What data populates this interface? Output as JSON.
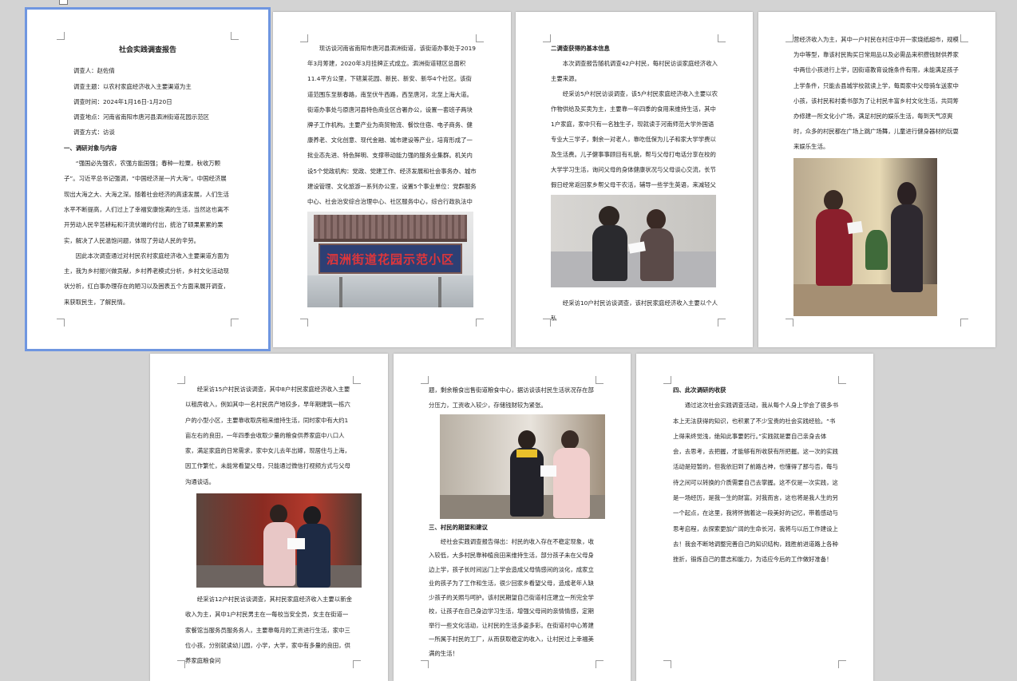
{
  "colors": {
    "background": "#d3d3d3",
    "selection": "#6f96e0"
  },
  "page1": {
    "title": "社会实践调查报告",
    "meta": [
      "调查人：赵佐倩",
      "调查主题：以农村家庭经济收入主要渠道为主",
      "调查时间：2024年1月16日-1月20日",
      "调查地点：河南省南阳市唐河县泗洲街道花园示范区",
      "调查方式：访谈"
    ],
    "heading1": "一、调研对象与内容",
    "paras": [
      "“强国必先强农，农强方能国强；春种一粒粟，秋收万颗子”。习近平总书记强调，“中国经济是一片大海”。中国经济展现出大海之大、大海之深。随着社会经济的高速发展，人们生活水平不断提高，人们过上了幸福安康饱满的生活，当然这也离不开劳动人民辛苦耕耘和汗流伏端的付出，统治了硕果累累的果实，解决了人民温饱问题，体现了劳动人民的辛劳。",
      "因此本次调查通过对村民农村家庭经济收入主要渠道方面为主，我为乡村振兴做贡献，乡村养老模式分析，乡村文化活动现状分析，红白事办理存在的陋习以及困表五个方面来展开调查，来获取民生，了解民情。"
    ]
  },
  "page2": {
    "paras": [
      "现访谈河南省南阳市唐河县泗洲街道，该街道办事处于2019年3月筹建，2020年3月挂牌正式成立。泗洲街道辖区总面积11.4平方公里，下辖莱花园、新民、新安、新华4个社区。该街道范围东至新春路，南至伏牛西路，西至唐河，北至上海大道。街道办事处与原唐河县特色商业区合署办公，设置一套班子两块牌子工作机构。主要产业为商贸物流、餐饮住宿、电子商务、健康养老、文化创意、现代金融、城市建设等产业，培育形成了一批业态先进、特色鲜明、支撑带动能力强的服务业集群。机关内设5个党政机构：党政、党建工作、经济发展和社会事务办、城市建设管理、文化旅游一系列办公室，设置5个事业单位：党群服务中心、社会治安综合治理中心、社区服务中心，综合行政执法中队、退役军人服务站。"
    ],
    "photo_sign": "泗洲街道花园示范小区"
  },
  "page3": {
    "heading": "二调查获得的基本信息",
    "paras": [
      "本次调查报告随机调查42户村民，每村民访谈家庭经济收入主要来源。",
      "经采访5户村民访谈调查，该5户村民家庭经济收入主要以农作物供给及买卖为主，主要靠一年四季的食用来维持生活，其中1户家庭，家中只有一名独生子，现就读于河南师范大学外国语专业大三学子，剩余一对老人，靠吃低保为儿子和家大学学费以及生活费。儿子健事事顾目有礼貌，帮与父母打电话分享在校的大学学习生活，询问父母的身体健康状况与父母谈心交流，长节假日经常返回家乡帮父母干农活，辅导一些学生英语，来减轻父母的压力。"
    ],
    "tail": "经采访10户村民访谈调查，该村民家庭经济收入主要以个人私"
  },
  "page4": {
    "paras": [
      "营经济收入为主，其中一户村民在村庄中开一家烧纸超市，规模为中等型，靠该村民购买日常用品以及必需品来积攒钱财供养家中两位小孩进行上学，因街道教育设施条件有限，未能满足孩子上学条件，只能去县城学校就读上学，每周家中父母骑车送家中小孩，该村民和村委书部为了让村民丰富乡村文化生活，共同筹办修建一所文化小广场，满足村民的娱乐生活，每到天气凉爽时，众多的村民都在广场上跳广场舞，儿童进行健身器材的玩耍来娱乐生活。"
    ]
  },
  "page5": {
    "paras": [
      "经采访15户村民访谈调查，其中8户村民家庭经济收入主要以租房收入，例如其中一名村民房产地较多，早年期建筑一栋六户的小型小区，主要靠收取房租来维持生活，同时家中有大约1亩左右的良田，一年四季会收取少量的粮食供养家庭中八口人家，满足家庭的日常需求，家中女儿去年出嫁，现居住与上海，因工作繁忙，未能常看望父母，只能通过微信打视频方式与父母沟通谈话。"
    ],
    "tail": "经采访12户村民访谈调查，其村民家庭经济收入主要以新金收入为主，其中1户村民男主在一每校当安全员，女主在街道一家餐馆当服务员服务务人，主要靠每月的工资进行生活，家中三位小孩，分别就读幼儿园，小学，大学，家中有多量的良田，供养家庭粮食问"
  },
  "page6": {
    "lead": "题，剩余粮食出售街道粮食中心，据访谈该村民生活状况存在部分压力，工资收入较少，存储钱财较为紧张。",
    "heading": "三、村民的期望和建议",
    "paras": [
      "经社会实践调查报告得出：村民的收入存在不稳定现象，收入较低，大多村民靠种植良田来维持生活，部分孩子未在父母身边上学，孩子长时间远门上学会造成父母情感间的淡化，成家立业的孩子为了工作和生活，很少回家乡看望父母，造成老年人缺少孩子的关照与呵护。该村民期望自己街道村庄建立一所完全学校，让孩子在自己身边学习生活，增强父母间的亲情情感，定期举行一些文化活动，让村民的生活多姿多彩。在街道村中心筹建一所属于村民的工厂，从而获取稳定的收入，让村民过上幸福美满的生活！"
    ]
  },
  "page7": {
    "heading": "四、此次调研的收获",
    "paras": [
      "通过这次社会实践调查活动，我从每个人身上学会了很多书本上无法获得的知识，也积累了不少宝贵的社会实践经验。“书上得来终觉浅，绝知此事要躬行。”实践就是要自己亲身去体会，去思考，去把握，才能够有所收获有所把握。这一次的实践活动是短暂的，但我依旧到了前路古神，也懂得了那与否，每与待之间可以转换的介质需要自己去掌握。这不仅是一次实践，这是一场经历，是我一生的财富。对我而言，这也将是我人生的另一个起点，在这里，我将怀揣着这一段美好的记忆，带着感动与思考启程，去探索更加广阔的生命长河，我将与以后工作建设上去！我会不断地调整完善自己的知识结构，践胜前进道路上各种挫折，锻炼自己的意志和能力，为适应今后的工作做好准备！"
    ]
  }
}
